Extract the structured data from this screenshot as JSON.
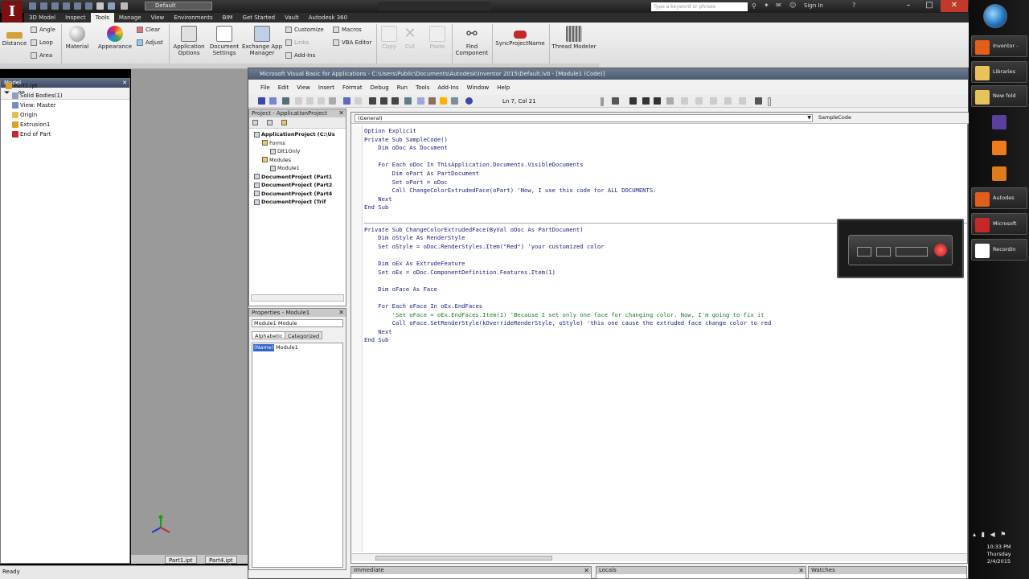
{
  "inventor": {
    "logo_letter": "I",
    "workspace": "Default",
    "title": "",
    "search_placeholder": "Type a keyword or phrase",
    "sign_in": "Sign In",
    "ribbon_tabs": [
      "3D Model",
      "Inspect",
      "Tools",
      "Manage",
      "View",
      "Environments",
      "BIM",
      "Get Started",
      "Vault",
      "Autodesk 360"
    ],
    "active_tab": "Tools",
    "ribbon": {
      "measure": {
        "distance": "Distance",
        "angle": "Angle",
        "loop": "Loop",
        "area": "Area"
      },
      "material": "Material",
      "appearance": "Appearance",
      "clear": "Clear",
      "adjust": "Adjust",
      "app_options": "Application Options",
      "doc_settings": "Document Settings",
      "exchange_app_manager": "Exchange App Manager",
      "customize": "Customize",
      "macros": "Macros",
      "links": "Links",
      "vba_editor": "VBA Editor",
      "add_ins": "Add-Ins",
      "copy": "Copy",
      "cut": "Cut",
      "paste": "Paste",
      "find_component": "Find Component",
      "sync_projectname": "SyncProjectName",
      "thread_modeler": "Thread Modeler"
    },
    "browser": {
      "title": "Model",
      "items": [
        "Part1.ipt",
        "Solid Bodies(1)",
        "View: Master",
        "Origin",
        "Extrusion1",
        "End of Part"
      ]
    },
    "doc_tabs": [
      "Part1.ipt",
      "Part4.ipt"
    ],
    "status": "Ready"
  },
  "vba": {
    "title": "Microsoft Visual Basic for Applications - C:\\Users\\Public\\Documents\\Autodesk\\Inventor 2015\\Default.ivb - [Module1 (Code)]",
    "menu": [
      "File",
      "Edit",
      "View",
      "Insert",
      "Format",
      "Debug",
      "Run",
      "Tools",
      "Add-Ins",
      "Window",
      "Help"
    ],
    "position": "Ln 7, Col 21",
    "project": {
      "title": "Project - ApplicationProject",
      "items": [
        {
          "text": "ApplicationProject (C:\\Us",
          "bold": true,
          "indent": 0
        },
        {
          "text": "Forms",
          "bold": false,
          "indent": 1
        },
        {
          "text": "Dlt1Only",
          "bold": false,
          "indent": 2
        },
        {
          "text": "Modules",
          "bold": false,
          "indent": 1
        },
        {
          "text": "Module1",
          "bold": false,
          "indent": 2
        },
        {
          "text": "DocumentProject (Part1",
          "bold": true,
          "indent": 0
        },
        {
          "text": "DocumentProject (Part2",
          "bold": true,
          "indent": 0
        },
        {
          "text": "DocumentProject (Part4",
          "bold": true,
          "indent": 0
        },
        {
          "text": "DocumentProject (Trif",
          "bold": true,
          "indent": 0
        }
      ]
    },
    "properties": {
      "title": "Properties - Module1",
      "object": "Module1 Module",
      "tabs": [
        "Alphabetic",
        "Categorized"
      ],
      "name_label": "(Name)",
      "name_value": "Module1"
    },
    "combos": {
      "object": "(General)",
      "procedure": "SampleCode"
    },
    "code": [
      {
        "t": "Option Explicit",
        "c": false
      },
      {
        "t": "Private Sub SampleCode()",
        "c": false
      },
      {
        "t": "    Dim oDoc As Document",
        "c": false
      },
      {
        "t": "",
        "c": false
      },
      {
        "t": "    For Each oDoc In ThisApplication.Documents.VisibleDocuments",
        "c": false
      },
      {
        "t": "        Dim oPart As PartDocument",
        "c": false
      },
      {
        "t": "        Set oPart = oDoc",
        "c": false
      },
      {
        "t": "        Call ChangeColorExtrudedFace(oPart) 'Now, I use this code for ALL DOCUMENTS.",
        "c": false
      },
      {
        "t": "    Next",
        "c": false
      },
      {
        "t": "End Sub",
        "c": false
      },
      {
        "t": "",
        "c": false
      },
      {
        "t": "Private Sub ChangeColorExtrudedFace(ByVal oDoc As PartDocument)",
        "c": false
      },
      {
        "t": "    Dim oStyle As RenderStyle",
        "c": false
      },
      {
        "t": "    Set oStyle = oDoc.RenderStyles.Item(\"Red\") 'your customized color",
        "c": false
      },
      {
        "t": "",
        "c": false
      },
      {
        "t": "    Dim oEx As ExtrudeFeature",
        "c": false
      },
      {
        "t": "    Set oEx = oDoc.ComponentDefinition.Features.Item(1)",
        "c": false
      },
      {
        "t": "",
        "c": false
      },
      {
        "t": "    Dim oFace As Face",
        "c": false
      },
      {
        "t": "",
        "c": false
      },
      {
        "t": "    For Each oFace In oEx.EndFaces",
        "c": false
      },
      {
        "t": "        'Set oFace = oEx.EndFaces.Item(1) 'Because I set only one face for changing color. Now, I'm going to fix it",
        "c": true
      },
      {
        "t": "        Call oFace.SetRenderStyle(kOverrideRenderStyle, oStyle) 'this one cause the extruded face change color to red",
        "c": false
      },
      {
        "t": "    Next",
        "c": false
      },
      {
        "t": "End Sub",
        "c": false
      }
    ],
    "bottom_panes": [
      "Immediate",
      "Locals",
      "Watches"
    ]
  },
  "taskbar": {
    "items": [
      {
        "label": "Inventor -",
        "color": "#e35d1b"
      },
      {
        "label": "Libraries",
        "color": "#e8c35a"
      },
      {
        "label": "New fold",
        "color": "#e8c35a"
      },
      {
        "label": "",
        "color": "#5a3f9e"
      },
      {
        "label": "",
        "color": "#f07b1c"
      },
      {
        "label": "",
        "color": "#e07b1c"
      },
      {
        "label": "Autodes",
        "color": "#e35d1b"
      },
      {
        "label": "Microsoft",
        "color": "#c62828"
      },
      {
        "label": "Recordin",
        "color": "#ffffff"
      }
    ],
    "time": "10:33 PM",
    "day": "Thursday",
    "date": "2/4/2015"
  }
}
